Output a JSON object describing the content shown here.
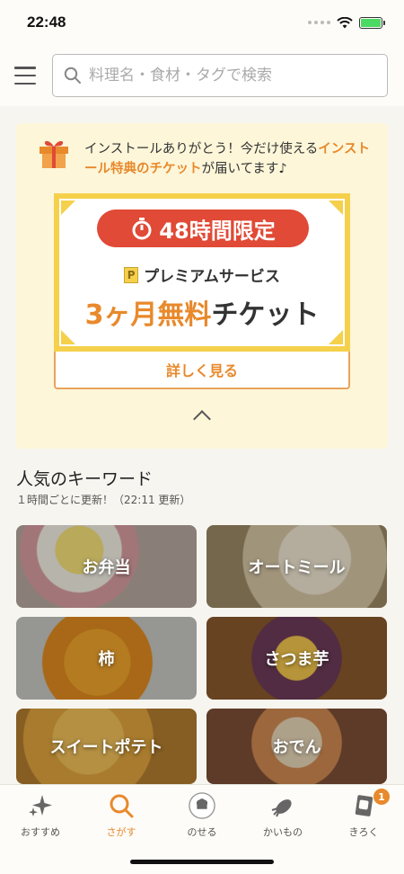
{
  "status": {
    "time": "22:48"
  },
  "search": {
    "placeholder": "料理名・食材・タグで検索"
  },
  "promo": {
    "message_part1": "インストールありがとう！今だけ使える",
    "message_highlight": "インストール特典のチケット",
    "message_part2": "が届いてます♪",
    "limit_text": "48時間限定",
    "premium_badge": "P",
    "premium_label": "プレミアムサービス",
    "free_orange": "3ヶ月無料",
    "free_dark": "チケット",
    "detail_button": "詳しく見る"
  },
  "keywords": {
    "title": "人気のキーワード",
    "subtitle": "１時間ごとに更新！（22:11 更新）",
    "items": [
      {
        "label": "お弁当"
      },
      {
        "label": "オートミール"
      },
      {
        "label": "柿"
      },
      {
        "label": "さつま芋"
      },
      {
        "label": "スイートポテト"
      },
      {
        "label": "おでん"
      }
    ]
  },
  "tabs": [
    {
      "label": "おすすめ",
      "icon": "sparkle-icon"
    },
    {
      "label": "さがす",
      "icon": "search-icon"
    },
    {
      "label": "のせる",
      "icon": "chef-hat-icon"
    },
    {
      "label": "かいもの",
      "icon": "vegetable-icon"
    },
    {
      "label": "きろく",
      "icon": "notebook-icon",
      "badge": "1"
    }
  ],
  "colors": {
    "accent": "#e8892c",
    "promo_bg": "#fdf6d9",
    "ticket_border": "#f5d04b",
    "pill_red": "#e04a36"
  }
}
